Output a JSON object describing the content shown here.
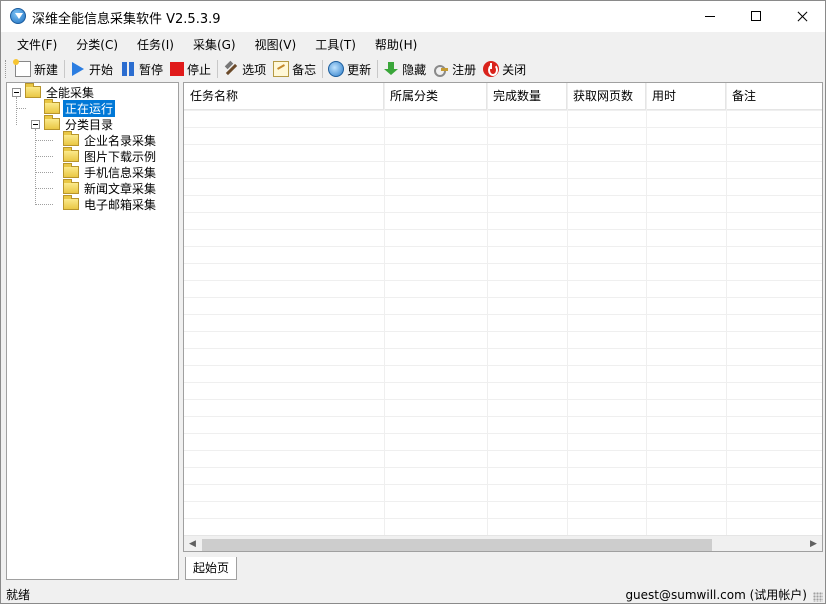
{
  "window": {
    "title": "深维全能信息采集软件 V2.5.3.9",
    "controls": {
      "minimize": "—",
      "maximize": "☐",
      "close": "✕"
    }
  },
  "menu": [
    {
      "label": "文件(F)"
    },
    {
      "label": "分类(C)"
    },
    {
      "label": "任务(I)"
    },
    {
      "label": "采集(G)"
    },
    {
      "label": "视图(V)"
    },
    {
      "label": "工具(T)"
    },
    {
      "label": "帮助(H)"
    }
  ],
  "toolbar": {
    "new": {
      "label": "新建",
      "icon": "new-file-icon"
    },
    "start": {
      "label": "开始",
      "icon": "play-icon"
    },
    "pause": {
      "label": "暂停",
      "icon": "pause-icon"
    },
    "stop": {
      "label": "停止",
      "icon": "stop-icon"
    },
    "options": {
      "label": "选项",
      "icon": "hammer-icon"
    },
    "memo": {
      "label": "备忘",
      "icon": "notepad-icon"
    },
    "update": {
      "label": "更新",
      "icon": "globe-icon"
    },
    "hide": {
      "label": "隐藏",
      "icon": "download-arrow-icon"
    },
    "register": {
      "label": "注册",
      "icon": "key-icon"
    },
    "close": {
      "label": "关闭",
      "icon": "power-icon"
    }
  },
  "tree": {
    "root": "全能采集",
    "running": "正在运行",
    "catalog": "分类目录",
    "categories": [
      "企业名录采集",
      "图片下载示例",
      "手机信息采集",
      "新闻文章采集",
      "电子邮箱采集"
    ]
  },
  "list": {
    "columns": [
      "任务名称",
      "所属分类",
      "完成数量",
      "获取网页数",
      "用时",
      "备注"
    ],
    "rows": []
  },
  "tabs": [
    "起始页"
  ],
  "status": {
    "left": "就绪",
    "right": "guest@sumwill.com (试用帐户)"
  },
  "colors": {
    "selection": "#0078d7",
    "stop": "#e01a1a",
    "accent": "#2b7de1"
  }
}
